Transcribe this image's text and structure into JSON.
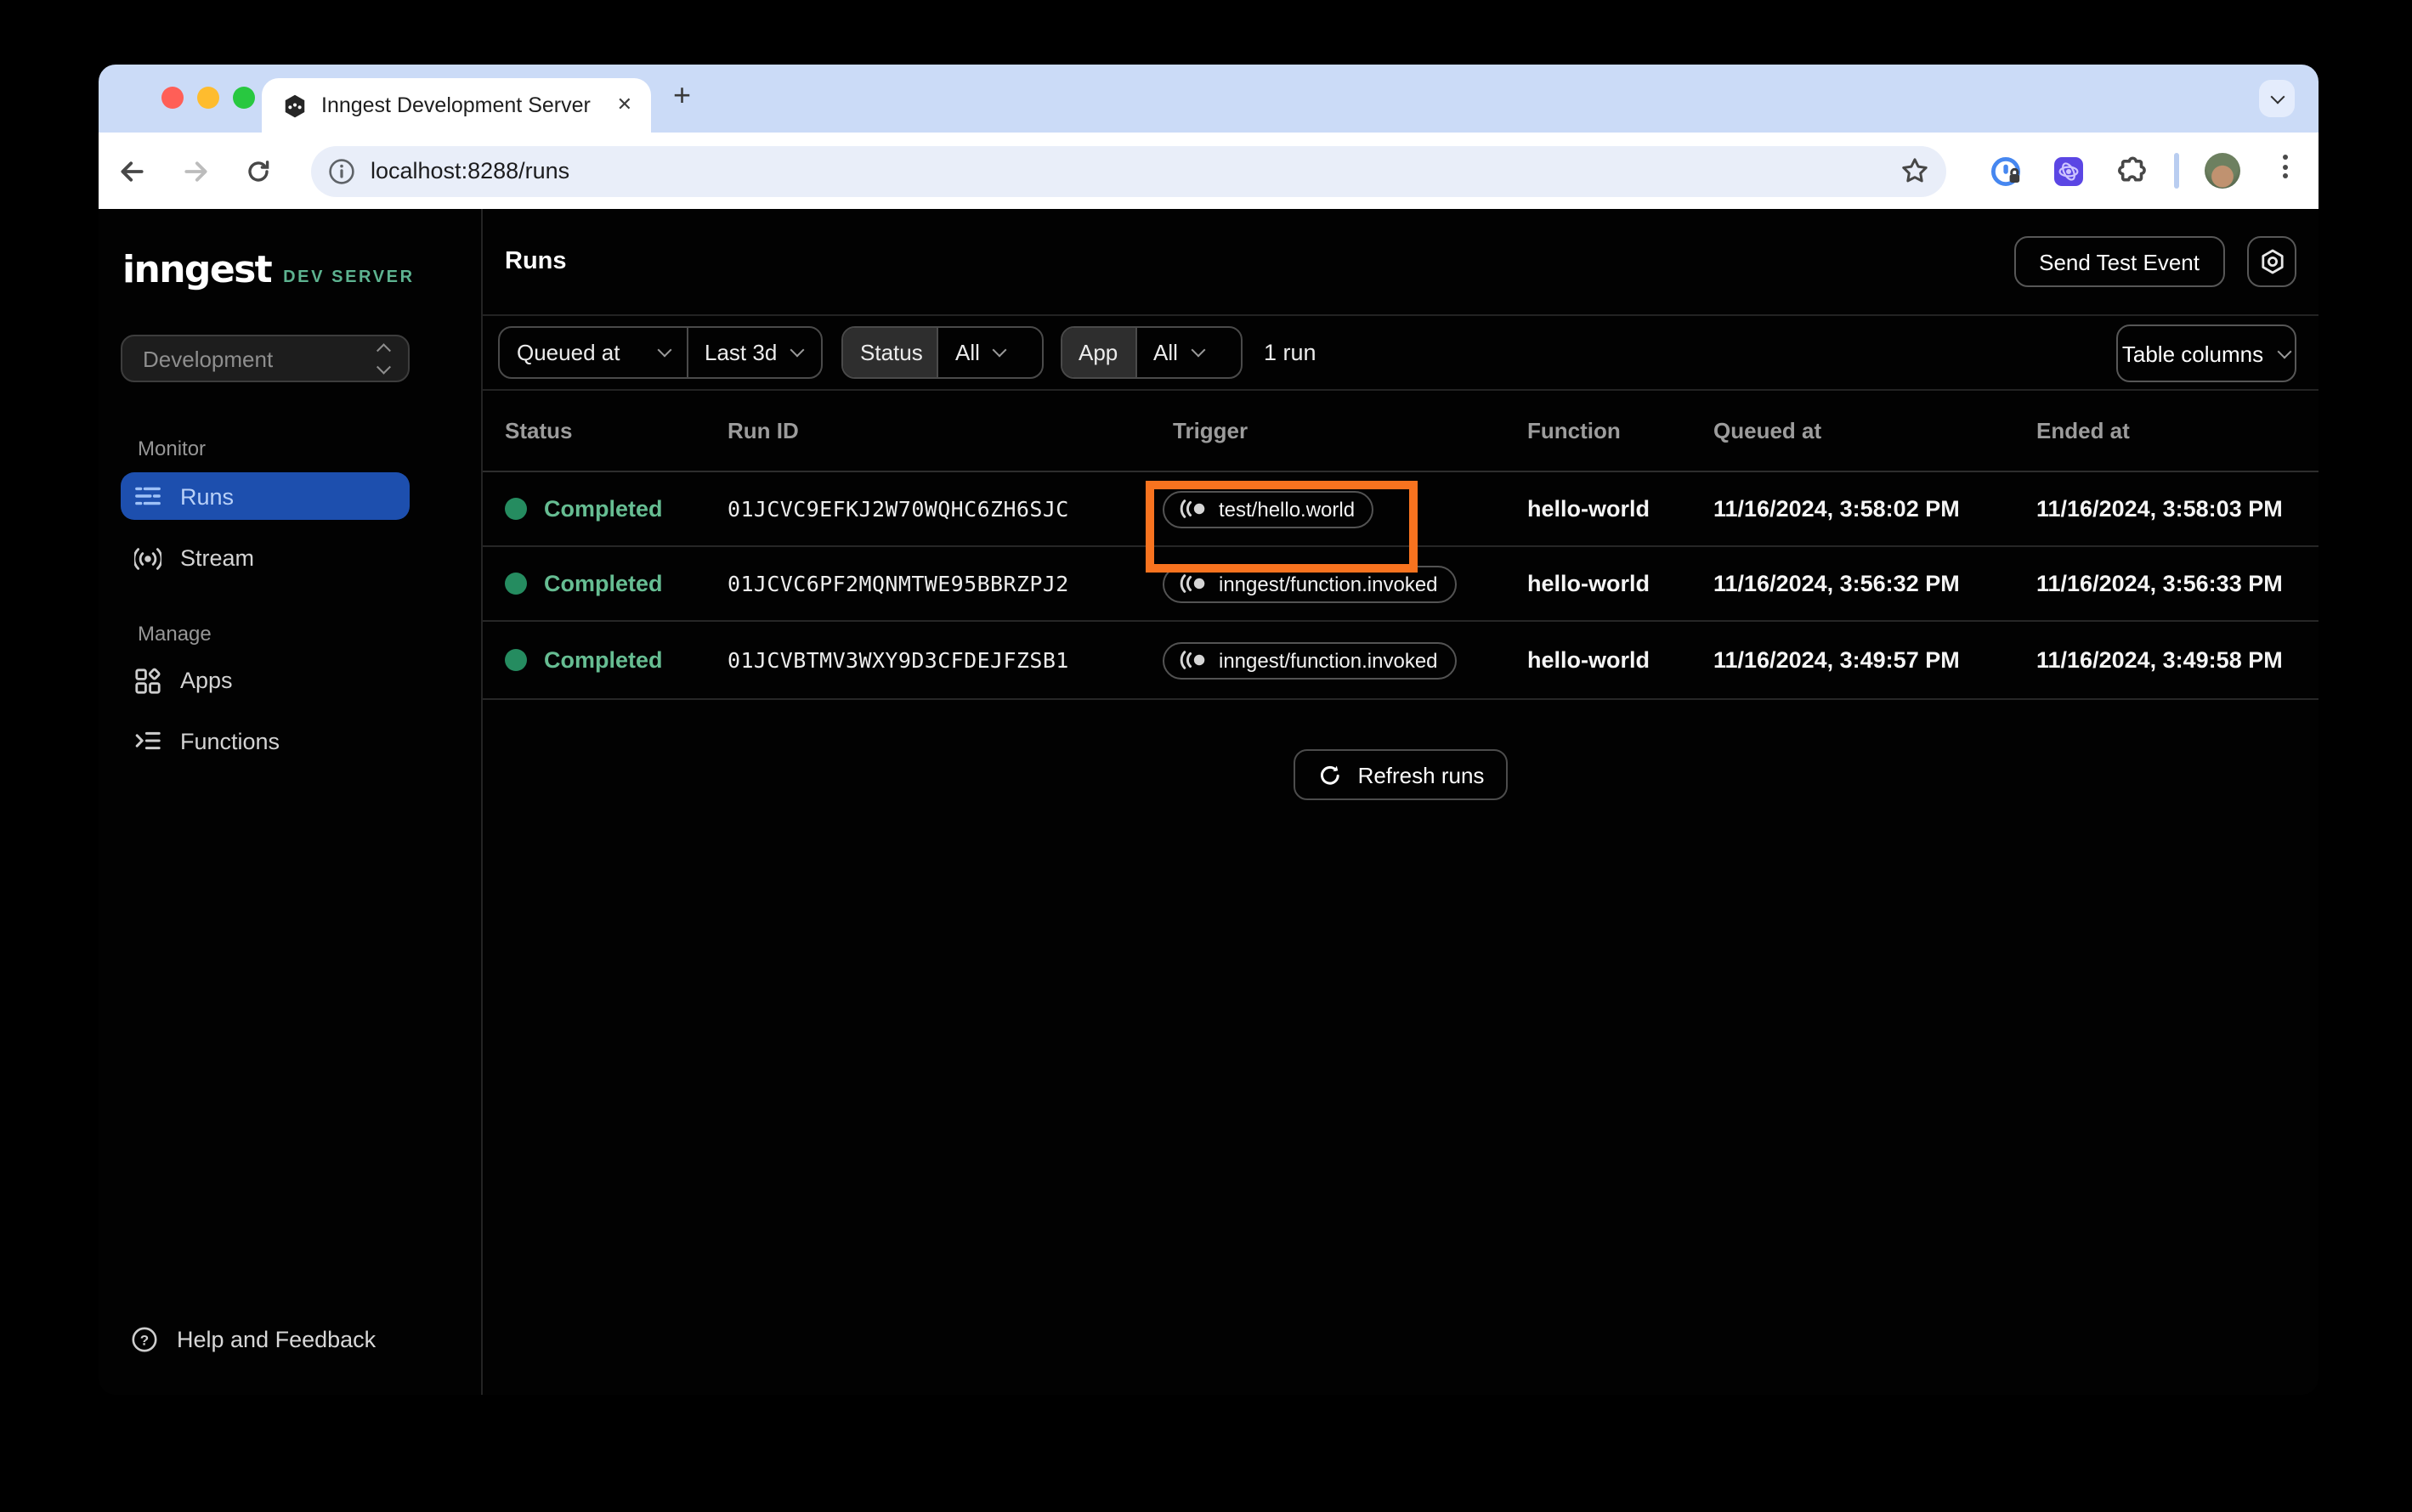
{
  "browser": {
    "tab_title": "Inngest Development Server",
    "close_icon": "✕",
    "new_tab_icon": "+",
    "url": "localhost:8288/runs"
  },
  "sidebar": {
    "logo": "inngest",
    "logo_badge": "DEV SERVER",
    "environment": "Development",
    "monitor_label": "Monitor",
    "manage_label": "Manage",
    "items": {
      "runs": "Runs",
      "stream": "Stream",
      "apps": "Apps",
      "functions": "Functions"
    },
    "help_label": "Help and Feedback"
  },
  "header": {
    "title": "Runs",
    "send_test_event_label": "Send Test Event"
  },
  "filters": {
    "queued_at_label": "Queued at",
    "time_range_value": "Last 3d",
    "status_label": "Status",
    "status_value": "All",
    "app_label": "App",
    "app_value": "All",
    "result_count": "1 run",
    "table_columns_label": "Table columns"
  },
  "table": {
    "columns": {
      "status": "Status",
      "run_id": "Run ID",
      "trigger": "Trigger",
      "function": "Function",
      "queued_at": "Queued at",
      "ended_at": "Ended at"
    },
    "rows": [
      {
        "status": "Completed",
        "run_id": "01JCVC9EFKJ2W70WQHC6ZH6SJC",
        "trigger": "test/hello.world",
        "function": "hello-world",
        "queued_at": "11/16/2024, 3:58:02 PM",
        "ended_at": "11/16/2024, 3:58:03 PM",
        "highlighted": true
      },
      {
        "status": "Completed",
        "run_id": "01JCVC6PF2MQNMTWE95BBRZPJ2",
        "trigger": "inngest/function.invoked",
        "function": "hello-world",
        "queued_at": "11/16/2024, 3:56:32 PM",
        "ended_at": "11/16/2024, 3:56:33 PM",
        "highlighted": false
      },
      {
        "status": "Completed",
        "run_id": "01JCVBTMV3WXY9D3CFDEJFZSB1",
        "trigger": "inngest/function.invoked",
        "function": "hello-world",
        "queued_at": "11/16/2024, 3:49:57 PM",
        "ended_at": "11/16/2024, 3:49:58 PM",
        "highlighted": false
      }
    ],
    "refresh_label": "Refresh runs"
  },
  "colors": {
    "accent_green": "#5db390",
    "status_text_green": "#66bd92",
    "status_dot_green": "#258c60",
    "active_nav_blue": "#1d4fae",
    "highlight_orange": "#f8731f",
    "tabstrip_blue": "#cbdbf7"
  }
}
